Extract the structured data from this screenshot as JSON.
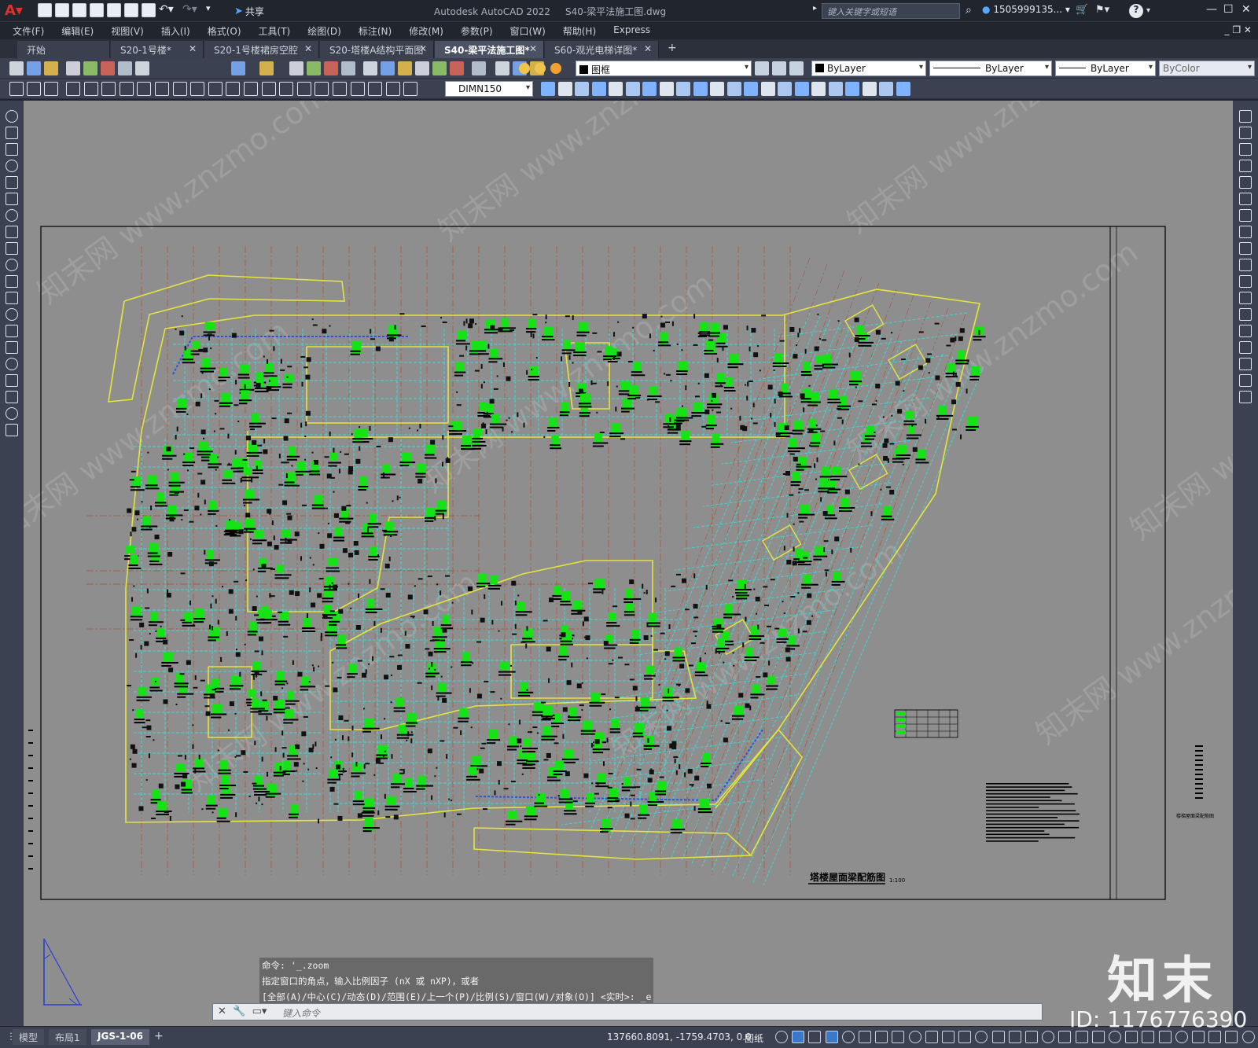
{
  "app": {
    "title_product": "Autodesk AutoCAD 2022",
    "title_file": "S40-梁平法施工图.dwg",
    "share_label": "共享",
    "search_placeholder": "键入关键字或短语",
    "user": "1505999135...",
    "help": "?"
  },
  "menu": [
    "文件(F)",
    "编辑(E)",
    "视图(V)",
    "插入(I)",
    "格式(O)",
    "工具(T)",
    "绘图(D)",
    "标注(N)",
    "修改(M)",
    "参数(P)",
    "窗口(W)",
    "帮助(H)",
    "Express"
  ],
  "file_tabs": [
    {
      "label": "开始",
      "closable": false,
      "active": false
    },
    {
      "label": "S20-1号楼*",
      "closable": true,
      "active": false
    },
    {
      "label": "S20-1号楼裙房空腔",
      "closable": true,
      "active": false
    },
    {
      "label": "S20-塔楼A结构平面图",
      "closable": true,
      "active": false
    },
    {
      "label": "S40-梁平法施工图*",
      "closable": true,
      "active": true
    },
    {
      "label": "S60-观光电梯详图*",
      "closable": true,
      "active": false
    }
  ],
  "add_tab": "+",
  "toolbar": {
    "layer_name": "图框",
    "color": "ByLayer",
    "linetype": "ByLayer",
    "lineweight": "ByLayer",
    "plotstyle": "ByColor",
    "dimstyle": "DIMN150"
  },
  "drawing": {
    "plan_title": "塔楼屋面梁配筋图",
    "scale": "1:100",
    "side_note": "楼梯屋面梁配筋图",
    "wire_color": "#e6e43c",
    "grid_color": "#43d6d6",
    "label_color": "#16e316",
    "axis_color": "#b0502a"
  },
  "command": {
    "history": [
      "命令: '_.zoom",
      "指定窗口的角点，输入比例因子 (nX 或 nXP)，或者",
      "[全部(A)/中心(C)/动态(D)/范围(E)/上一个(P)/比例(S)/窗口(W)/对象(O)] <实时>: _e"
    ],
    "placeholder": "键入命令"
  },
  "layout_tabs": [
    {
      "label": "模型",
      "active": false
    },
    {
      "label": "布局1",
      "active": false
    },
    {
      "label": "JGS-1-06",
      "active": true
    }
  ],
  "status": {
    "coords": "137660.8091, -1759.4703, 0.0...",
    "space": "图纸"
  },
  "watermark": {
    "brand": "知末",
    "id_text": "ID: 1176776390",
    "site": "知末网 www.znzmo.com"
  }
}
